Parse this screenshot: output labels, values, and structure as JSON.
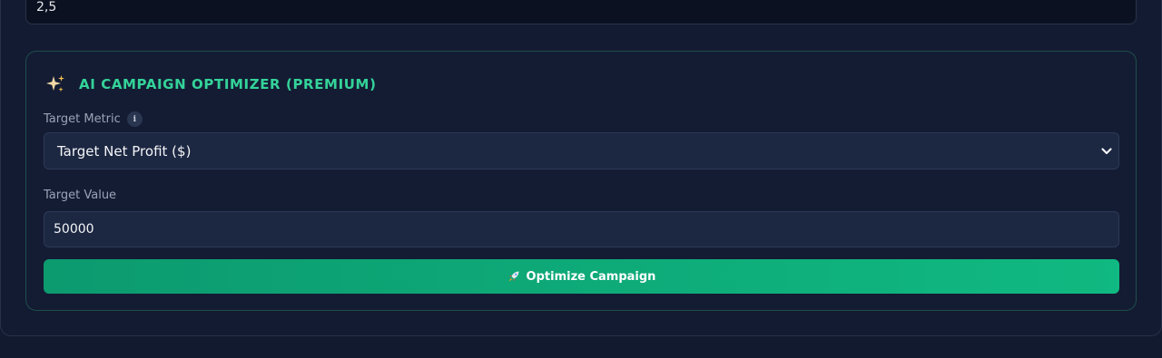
{
  "previous_field": {
    "value": "2,5"
  },
  "optimizer": {
    "title": "AI CAMPAIGN OPTIMIZER (PREMIUM)",
    "icon": "sparkles-icon",
    "accent_color": "#34d399",
    "target_metric": {
      "label": "Target Metric",
      "info_icon": "i",
      "selected": "Target Net Profit ($)"
    },
    "target_value": {
      "label": "Target Value",
      "value": "50000"
    },
    "button": {
      "label": "Optimize Campaign",
      "icon": "rocket-icon",
      "color_start": "#0c9a6f",
      "color_end": "#10b981"
    }
  }
}
